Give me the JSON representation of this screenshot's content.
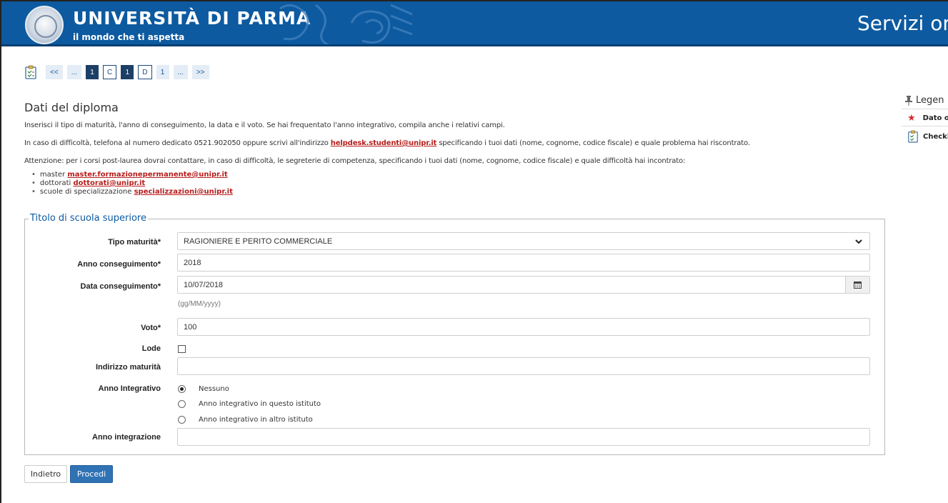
{
  "header": {
    "brand_title": "UNIVERSITÀ DI PARMA",
    "brand_subtitle": "il mondo che ti aspetta",
    "services_title": "Servizi onli",
    "colors": {
      "header_bg": "#0d5aa0",
      "accent": "#2f73b5",
      "link": "#b71c1c"
    }
  },
  "pager": {
    "icon": "checklist-icon",
    "items": [
      {
        "label": "<<",
        "type": "nav"
      },
      {
        "label": "...",
        "type": "nav"
      },
      {
        "label": "1",
        "type": "active"
      },
      {
        "label": "C",
        "type": "letter"
      },
      {
        "label": "1",
        "type": "active"
      },
      {
        "label": "D",
        "type": "letter"
      },
      {
        "label": "1",
        "type": "nav"
      },
      {
        "label": "...",
        "type": "nav"
      },
      {
        "label": ">>",
        "type": "nav"
      }
    ]
  },
  "main": {
    "title": "Dati del diploma",
    "intro": "Inserisci il tipo di maturità, l'anno di conseguimento, la data e il voto. Se hai frequentato l'anno integrativo, compila anche i relativi campi.",
    "help_before": "In caso di difficoltà, telefona al numero dedicato 0521.902050 oppure scrivi all'indirizzo ",
    "help_email": "helpdesk.studenti@unipr.it",
    "help_after": " specificando i tuoi dati (nome, cognome, codice fiscale) e quale problema hai riscontrato.",
    "warning": "Attenzione: per i corsi post-laurea dovrai contattare, in caso di difficoltà, le segreterie di competenza, specificando i tuoi dati (nome, cognome, codice fiscale) e quale difficoltà hai incontrato:",
    "contacts": [
      {
        "label": "master",
        "email": "master.formazionepermanente@unipr.it"
      },
      {
        "label": "dottorati",
        "email": "dottorati@unipr.it"
      },
      {
        "label": "scuole di specializzazione",
        "email": "specializzazioni@unipr.it"
      }
    ]
  },
  "form": {
    "legend": "Titolo di scuola superiore",
    "tipo_maturita": {
      "label": "Tipo maturità*",
      "value": "RAGIONIERE E PERITO COMMERCIALE"
    },
    "anno_conseguimento": {
      "label": "Anno conseguimento*",
      "value": "2018"
    },
    "data_conseguimento": {
      "label": "Data conseguimento*",
      "value": "10/07/2018",
      "hint": "(gg/MM/yyyy)"
    },
    "voto": {
      "label": "Voto*",
      "value": "100"
    },
    "lode": {
      "label": "Lode",
      "checked": false
    },
    "indirizzo": {
      "label": "Indirizzo maturità",
      "value": ""
    },
    "anno_integrativo": {
      "label": "Anno Integrativo",
      "options": [
        "Nessuno",
        "Anno integrativo in questo istituto",
        "Anno integrativo in altro istituto"
      ],
      "selected": 0
    },
    "anno_integrazione": {
      "label": "Anno integrazione",
      "value": ""
    }
  },
  "buttons": {
    "back": "Indietro",
    "next": "Procedi"
  },
  "sidebar": {
    "title": "Legen",
    "items": [
      {
        "icon": "star-icon",
        "label": "Dato o"
      },
      {
        "icon": "checklist-icon",
        "label": "Checkl"
      }
    ]
  }
}
